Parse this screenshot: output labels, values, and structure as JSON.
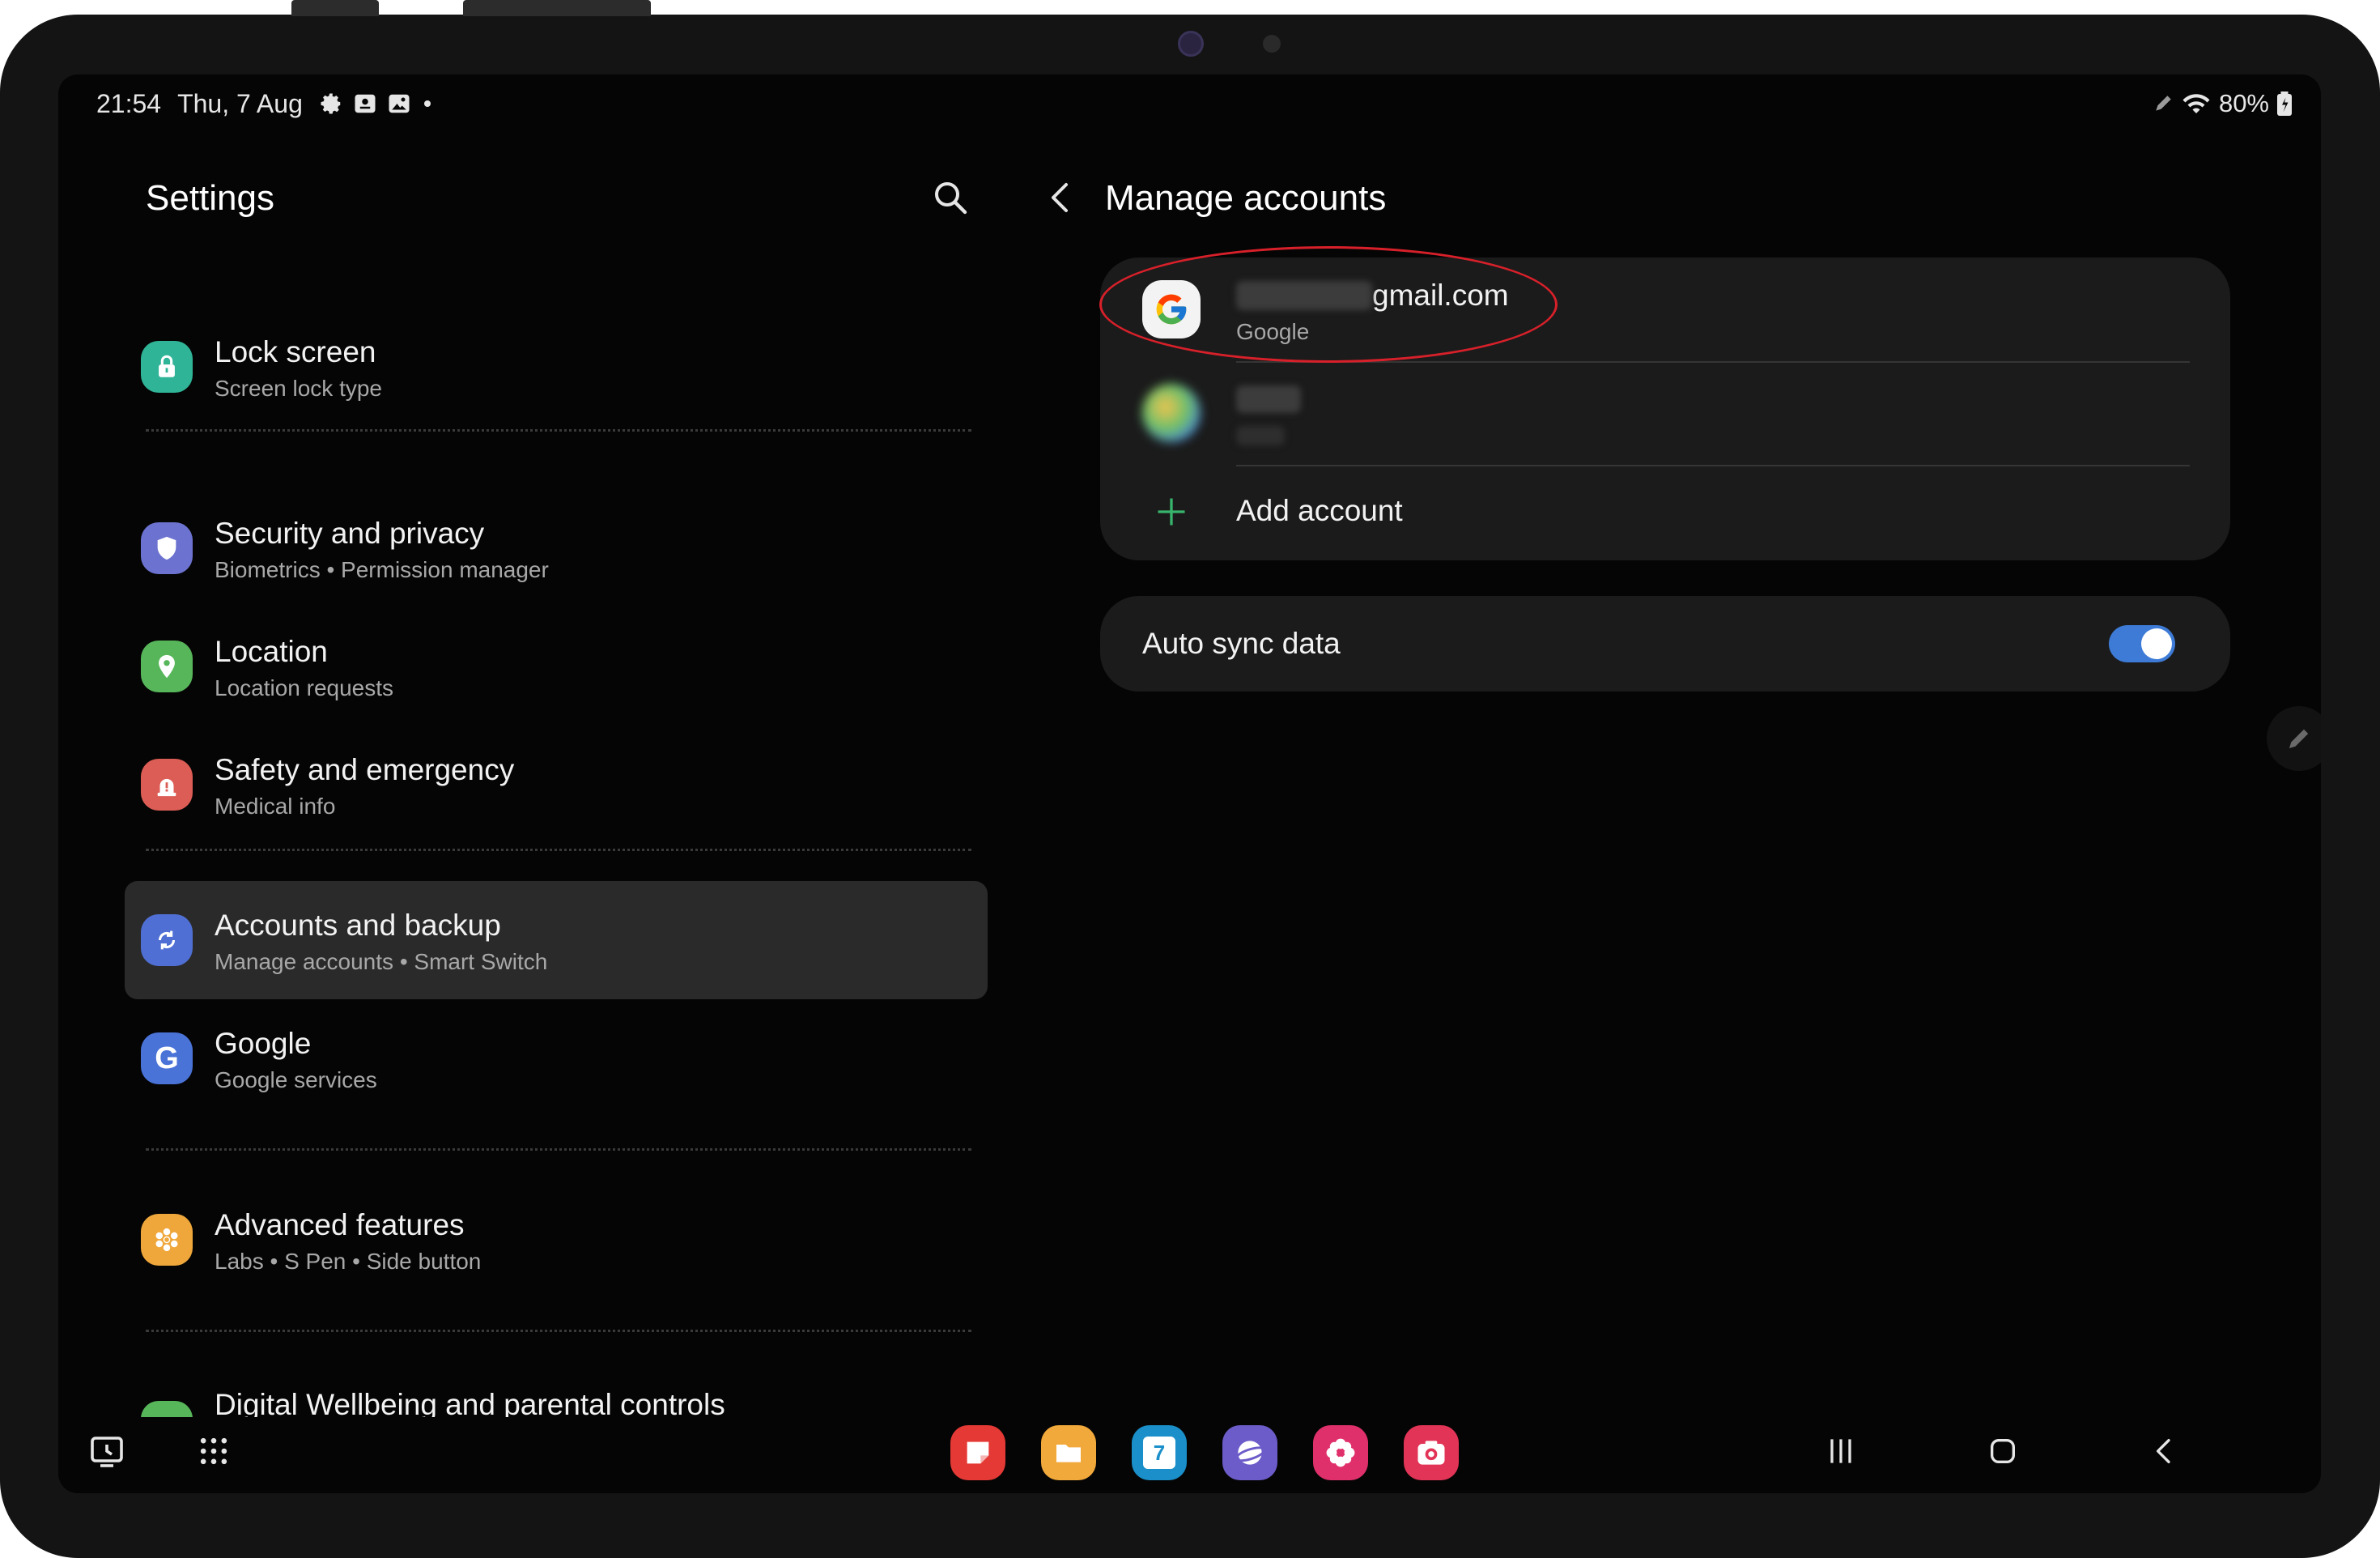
{
  "status_bar": {
    "time": "21:54",
    "date": "Thu, 7 Aug",
    "notification_icons": [
      "settings-icon",
      "voice-recorder-icon",
      "gallery-icon",
      "more-dot-icon"
    ],
    "right_icons": [
      "s-pen-icon",
      "wifi-icon"
    ],
    "battery": "80%"
  },
  "settings": {
    "title": "Settings",
    "items": [
      {
        "title": "Lock screen",
        "subtitle": "Screen lock type",
        "icon": "lock-icon",
        "color": "#2fb497"
      },
      {
        "title": "Security and privacy",
        "subtitle": "Biometrics  •  Permission manager",
        "icon": "shield-icon",
        "color": "#6c72cf"
      },
      {
        "title": "Location",
        "subtitle": "Location requests",
        "icon": "location-pin-icon",
        "color": "#57b65a"
      },
      {
        "title": "Safety and emergency",
        "subtitle": "Medical info",
        "icon": "alert-icon",
        "color": "#dc5d55"
      },
      {
        "title": "Accounts and backup",
        "subtitle": "Manage accounts  •  Smart Switch",
        "icon": "sync-icon",
        "color": "#4f6fd4"
      },
      {
        "title": "Google",
        "subtitle": "Google services",
        "icon": "google-icon",
        "color": "#4a73d8"
      },
      {
        "title": "Advanced features",
        "subtitle": "Labs  •  S Pen  •  Side button",
        "icon": "star-gear-icon",
        "color": "#efa73b"
      },
      {
        "title": "Digital Wellbeing and parental controls",
        "subtitle": "",
        "icon": "wellbeing-icon",
        "color": "#57b65a"
      }
    ]
  },
  "manage_accounts": {
    "title": "Manage accounts",
    "accounts": [
      {
        "email_visible": "gmail.com",
        "type": "Google"
      }
    ],
    "add_account_label": "Add account",
    "auto_sync_label": "Auto sync data",
    "auto_sync_on": true
  },
  "colors": {
    "background": "#050505",
    "card": "#1b1b1b",
    "active_item": "#2a2a2a",
    "toggle_on": "#3d7bd6",
    "annotation": "#d8202a",
    "add_icon": "#38b56c"
  },
  "taskbar": {
    "left_buttons": [
      "screen-recorder-icon",
      "apps-grid-icon"
    ],
    "dock_apps": [
      {
        "name": "notes-app-icon",
        "color": "#e53935"
      },
      {
        "name": "my-files-app-icon",
        "color": "#f2a93b"
      },
      {
        "name": "calendar-app-icon",
        "color": "#1a8fc9",
        "text": "7"
      },
      {
        "name": "internet-app-icon",
        "color": "#6c5cc9"
      },
      {
        "name": "gallery-app-icon",
        "color": "#e0306b"
      },
      {
        "name": "camera-app-icon",
        "color": "#e23456"
      }
    ],
    "nav_buttons": [
      "recents-icon",
      "home-icon",
      "back-icon"
    ]
  }
}
